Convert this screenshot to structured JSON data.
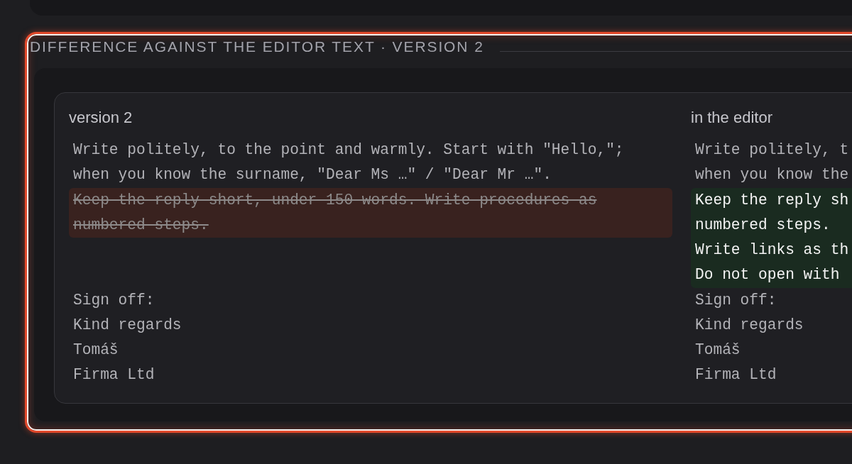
{
  "diff_section": {
    "title": "DIFFERENCE AGAINST THE EDITOR TEXT · VERSION 2",
    "highlighted": true,
    "columns": [
      {
        "heading": "version 2"
      },
      {
        "heading": "in the editor"
      }
    ],
    "hunks": [
      {
        "left": {
          "kind": "same",
          "lines": [
            "Write politely, to the point and warmly. Start with \"Hello,\";",
            "when you know the surname, \"Dear Ms …\" / \"Dear Mr …\"."
          ]
        },
        "right": {
          "kind": "same",
          "lines": [
            "Write politely, t",
            "when you know the"
          ]
        }
      },
      {
        "left": {
          "kind": "removed",
          "lines": [
            "Keep the reply short, under 150 words. Write procedures as",
            "numbered steps."
          ]
        },
        "right": {
          "kind": "added",
          "lines": [
            "Keep the reply sh",
            "numbered steps.",
            "Write links as th",
            "Do not open with"
          ]
        }
      },
      {
        "left": {
          "kind": "same",
          "lines": [
            "Sign off:",
            "Kind regards",
            "Tomáš",
            "Firma Ltd"
          ]
        },
        "right": {
          "kind": "same",
          "lines": [
            "Sign off:",
            "Kind regards",
            "Tomáš",
            "Firma Ltd"
          ]
        }
      }
    ]
  }
}
